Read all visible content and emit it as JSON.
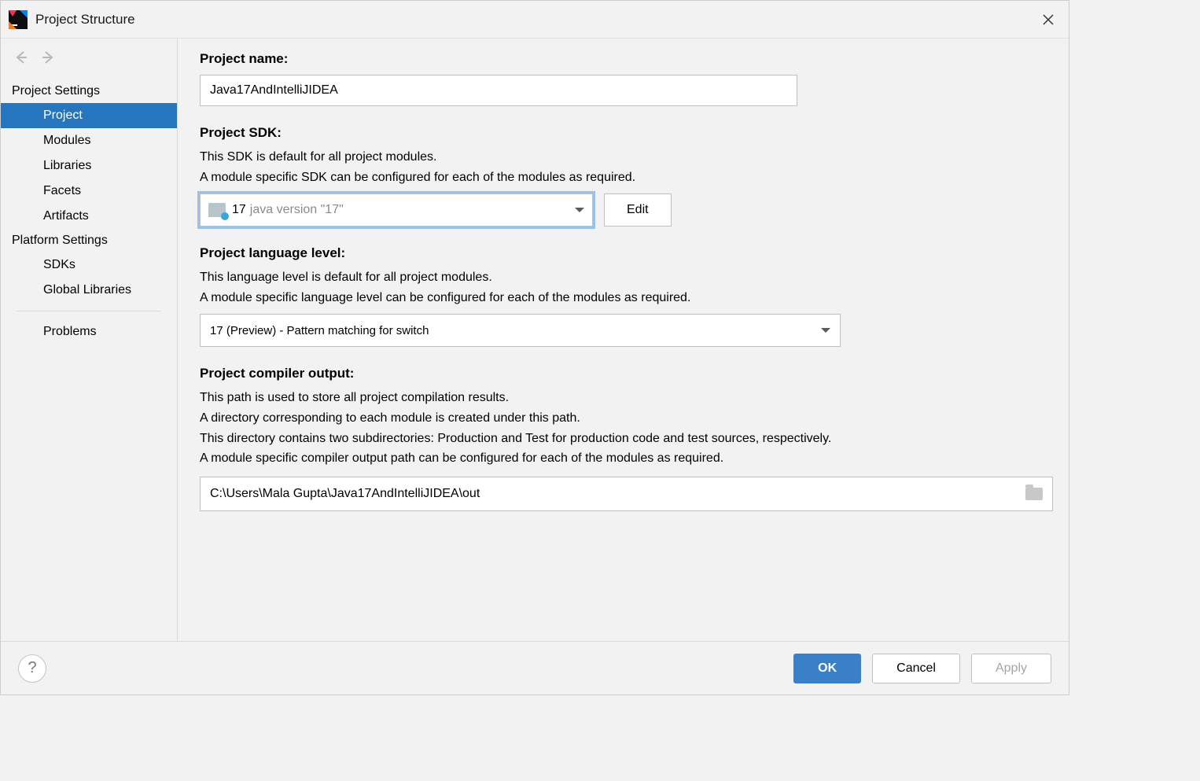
{
  "window": {
    "title": "Project Structure"
  },
  "sidebar": {
    "section_project_settings": "Project Settings",
    "section_platform_settings": "Platform Settings",
    "items": {
      "project": "Project",
      "modules": "Modules",
      "libraries": "Libraries",
      "facets": "Facets",
      "artifacts": "Artifacts",
      "sdks": "SDKs",
      "global_libraries": "Global Libraries",
      "problems": "Problems"
    }
  },
  "main": {
    "project_name_label": "Project name:",
    "project_name_value": "Java17AndIntelliJIDEA",
    "project_sdk_label": "Project SDK:",
    "sdk_desc_1": "This SDK is default for all project modules.",
    "sdk_desc_2": "A module specific SDK can be configured for each of the modules as required.",
    "sdk_selected_prefix": "17",
    "sdk_selected_suffix": "java version \"17\"",
    "edit_label": "Edit",
    "lang_level_label": "Project language level:",
    "lang_desc_1": "This language level is default for all project modules.",
    "lang_desc_2": "A module specific language level can be configured for each of the modules as required.",
    "lang_level_selected": "17 (Preview) - Pattern matching for switch",
    "compiler_output_label": "Project compiler output:",
    "compiler_desc_1": "This path is used to store all project compilation results.",
    "compiler_desc_2": "A directory corresponding to each module is created under this path.",
    "compiler_desc_3": "This directory contains two subdirectories: Production and Test for production code and test sources, respectively.",
    "compiler_desc_4": "A module specific compiler output path can be configured for each of the modules as required.",
    "compiler_output_value": "C:\\Users\\Mala Gupta\\Java17AndIntelliJIDEA\\out"
  },
  "footer": {
    "help": "?",
    "ok": "OK",
    "cancel": "Cancel",
    "apply": "Apply"
  }
}
